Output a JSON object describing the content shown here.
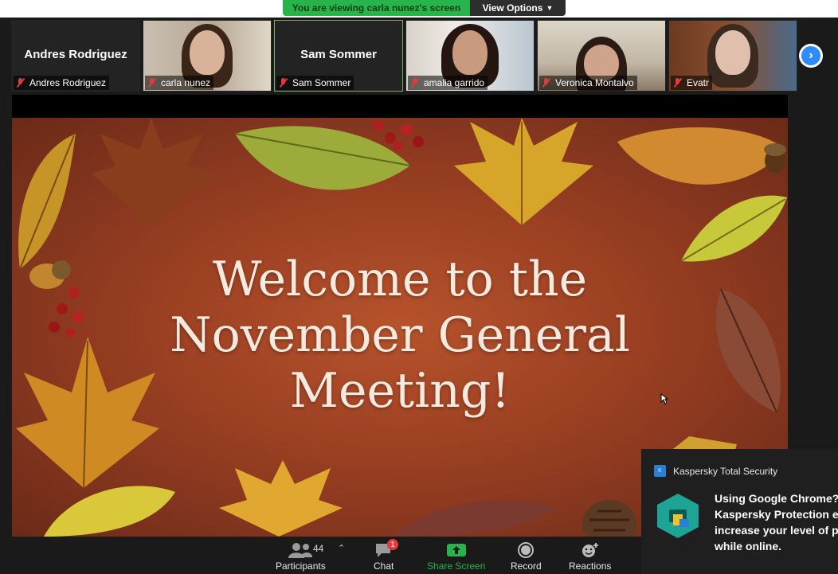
{
  "banner": {
    "viewing_text": "You are viewing carla nunez's screen",
    "view_options_label": "View Options",
    "view_options_icon": "chevron-down-icon"
  },
  "participants": [
    {
      "display": "Andres Rodriguez",
      "name_tag": "Andres Rodriguez",
      "video": false,
      "muted": true,
      "active": false
    },
    {
      "display": "",
      "name_tag": "carla nunez",
      "video": true,
      "muted": true,
      "active": false
    },
    {
      "display": "Sam Sommer",
      "name_tag": "Sam Sommer",
      "video": false,
      "muted": true,
      "active": true
    },
    {
      "display": "",
      "name_tag": "amalia garrido",
      "video": true,
      "muted": true,
      "active": false
    },
    {
      "display": "",
      "name_tag": "Veronica Montalvo",
      "video": true,
      "muted": true,
      "active": false
    },
    {
      "display": "",
      "name_tag": "Evatr",
      "video": true,
      "muted": true,
      "active": false
    }
  ],
  "next_page_icon": "chevron-right-icon",
  "slide": {
    "title_lines": [
      "Welcome to the",
      "November General",
      "Meeting!"
    ]
  },
  "toolbar": {
    "participants_label": "Participants",
    "participants_count": "44",
    "chat_label": "Chat",
    "chat_badge": "1",
    "share_label": "Share Screen",
    "record_label": "Record",
    "reactions_label": "Reactions"
  },
  "toast": {
    "app_name": "Kaspersky Total Security",
    "message_lines": [
      "Using Google Chrome?",
      "Kaspersky Protection e",
      "increase your level of p",
      "while online."
    ]
  },
  "colors": {
    "accent_green": "#27b44a",
    "zoom_blue": "#2d8cff",
    "muted_red": "#e03c3c",
    "slide_bg": "#9a3f22"
  }
}
